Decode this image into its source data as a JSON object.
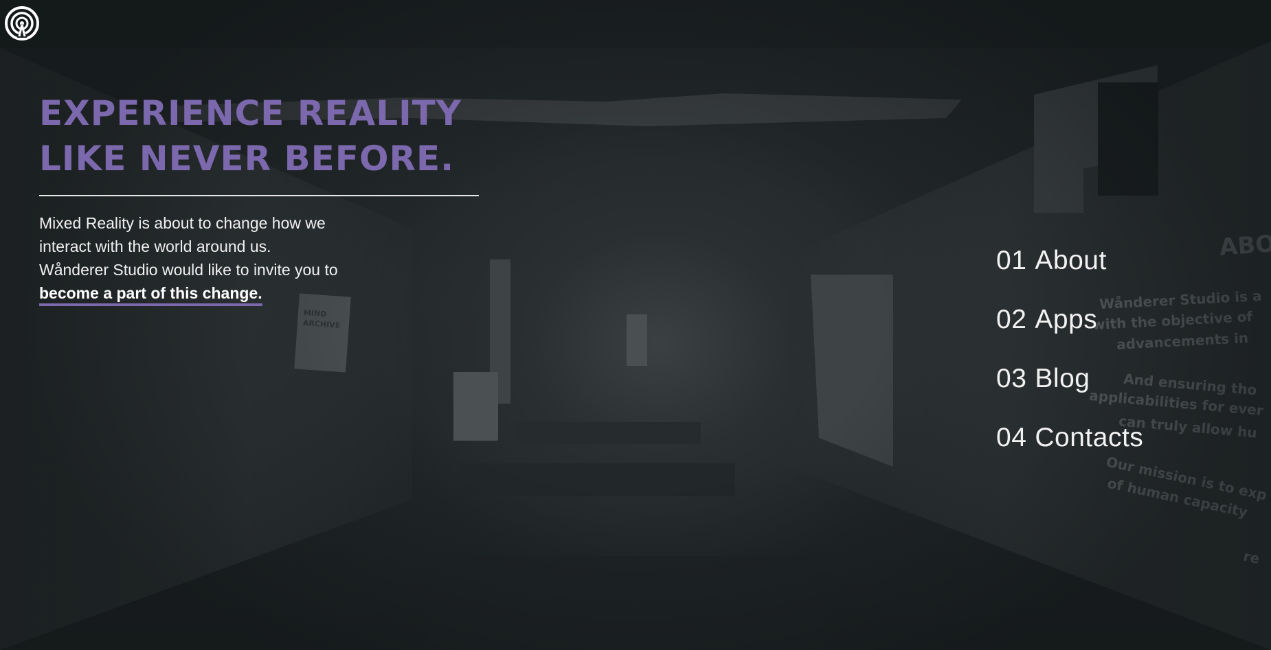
{
  "logo": {
    "icon": "broadcast-icon",
    "color": "#ffffff"
  },
  "hero": {
    "title_line1": "EXPERIENCE REALITY",
    "title_line2": "LIKE NEVER BEFORE.",
    "body_line1": "Mixed Reality is about to change how we",
    "body_line2": "interact with the world around us.",
    "body_line3": "Wånderer Studio would like to invite you to",
    "cta": "become a part of this change."
  },
  "nav": {
    "items": [
      {
        "num": "01",
        "label": "About"
      },
      {
        "num": "02",
        "label": "Apps"
      },
      {
        "num": "03",
        "label": "Blog"
      },
      {
        "num": "04",
        "label": "Contacts"
      }
    ]
  },
  "background": {
    "poster_line1": "MIND",
    "poster_line2": "ARCHIVE",
    "wall_title": "ABO",
    "wall_lines": [
      "Wånderer Studio is a",
      "with the objective of",
      "advancements in",
      "And ensuring tho",
      "applicabilities for ever",
      "can truly allow hu",
      "Our mission is to exp",
      "of human capacity",
      "re"
    ]
  },
  "colors": {
    "accent": "#7b68ad",
    "background": "#1c2123",
    "text": "#f0f0f0"
  }
}
